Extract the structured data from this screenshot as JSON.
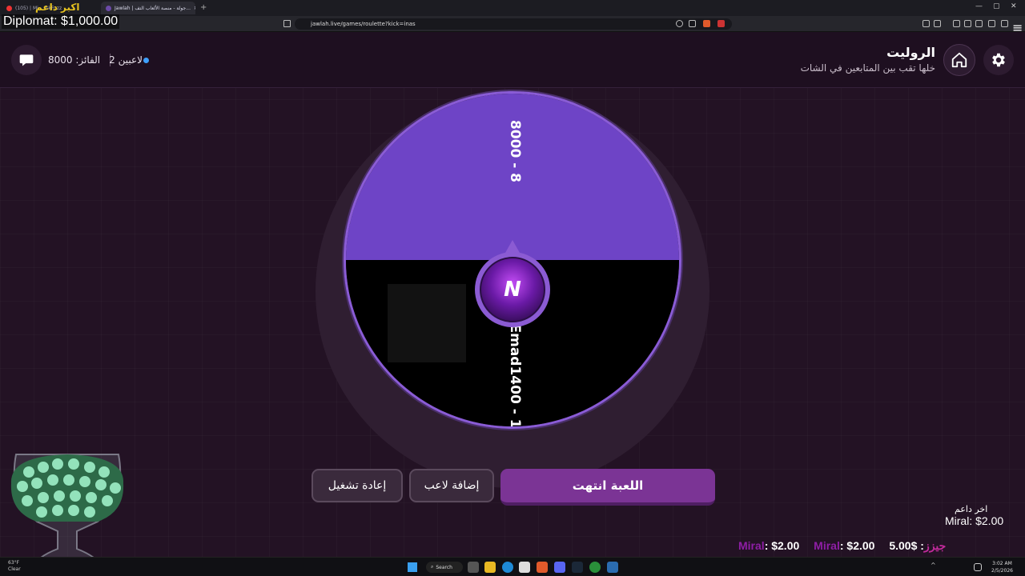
{
  "browser": {
    "tabs": [
      {
        "label": "(105) | Mi... ickFuzz"
      },
      {
        "label": "Jawlah | جولة - منصة الألعاب التف..."
      }
    ],
    "url": "jawlah.live/games/roulette?kick=inas"
  },
  "stream_overlay": {
    "latest_sub_label": "اكبر داعم",
    "diplomat_text": "Diplomat: $1,000.00",
    "latest_donor_title": "اخر داعم",
    "latest_donor_entry": "Miral: $2.00",
    "ticker": [
      {
        "name": "Miral",
        "amount": ": $2.00"
      },
      {
        "name": "Miral",
        "amount": ": $2.00"
      },
      {
        "name": "جيزز",
        "amount": "5.00$ :"
      }
    ]
  },
  "header": {
    "title": "الروليت",
    "subtitle": "خلها تقب بين المتابعين في الشات",
    "winner_label": "الفائز: 8000",
    "players_count": "2 لاعبين"
  },
  "wheel": {
    "segments": [
      {
        "label": "8000 - 8",
        "color": "#6e44c6"
      },
      {
        "label": "Emad1400 - 1",
        "color": "#000000"
      }
    ],
    "center_logo": "N"
  },
  "buttons": {
    "game_over": "اللعبة انتهت",
    "add_player": "إضافة لاعب",
    "restart": "إعادة تشغيل"
  },
  "taskbar": {
    "weather_temp": "63°F",
    "weather_desc": "Clear",
    "search": "Search",
    "time": "3:02 AM",
    "date": "2/5/2026"
  },
  "colors": {
    "accent": "#7b3495",
    "wheel_purple": "#6e44c6",
    "background": "#231224"
  },
  "icons": [
    "settings-icon",
    "home-icon",
    "chat-icon",
    "search-icon",
    "windows-start-icon"
  ]
}
